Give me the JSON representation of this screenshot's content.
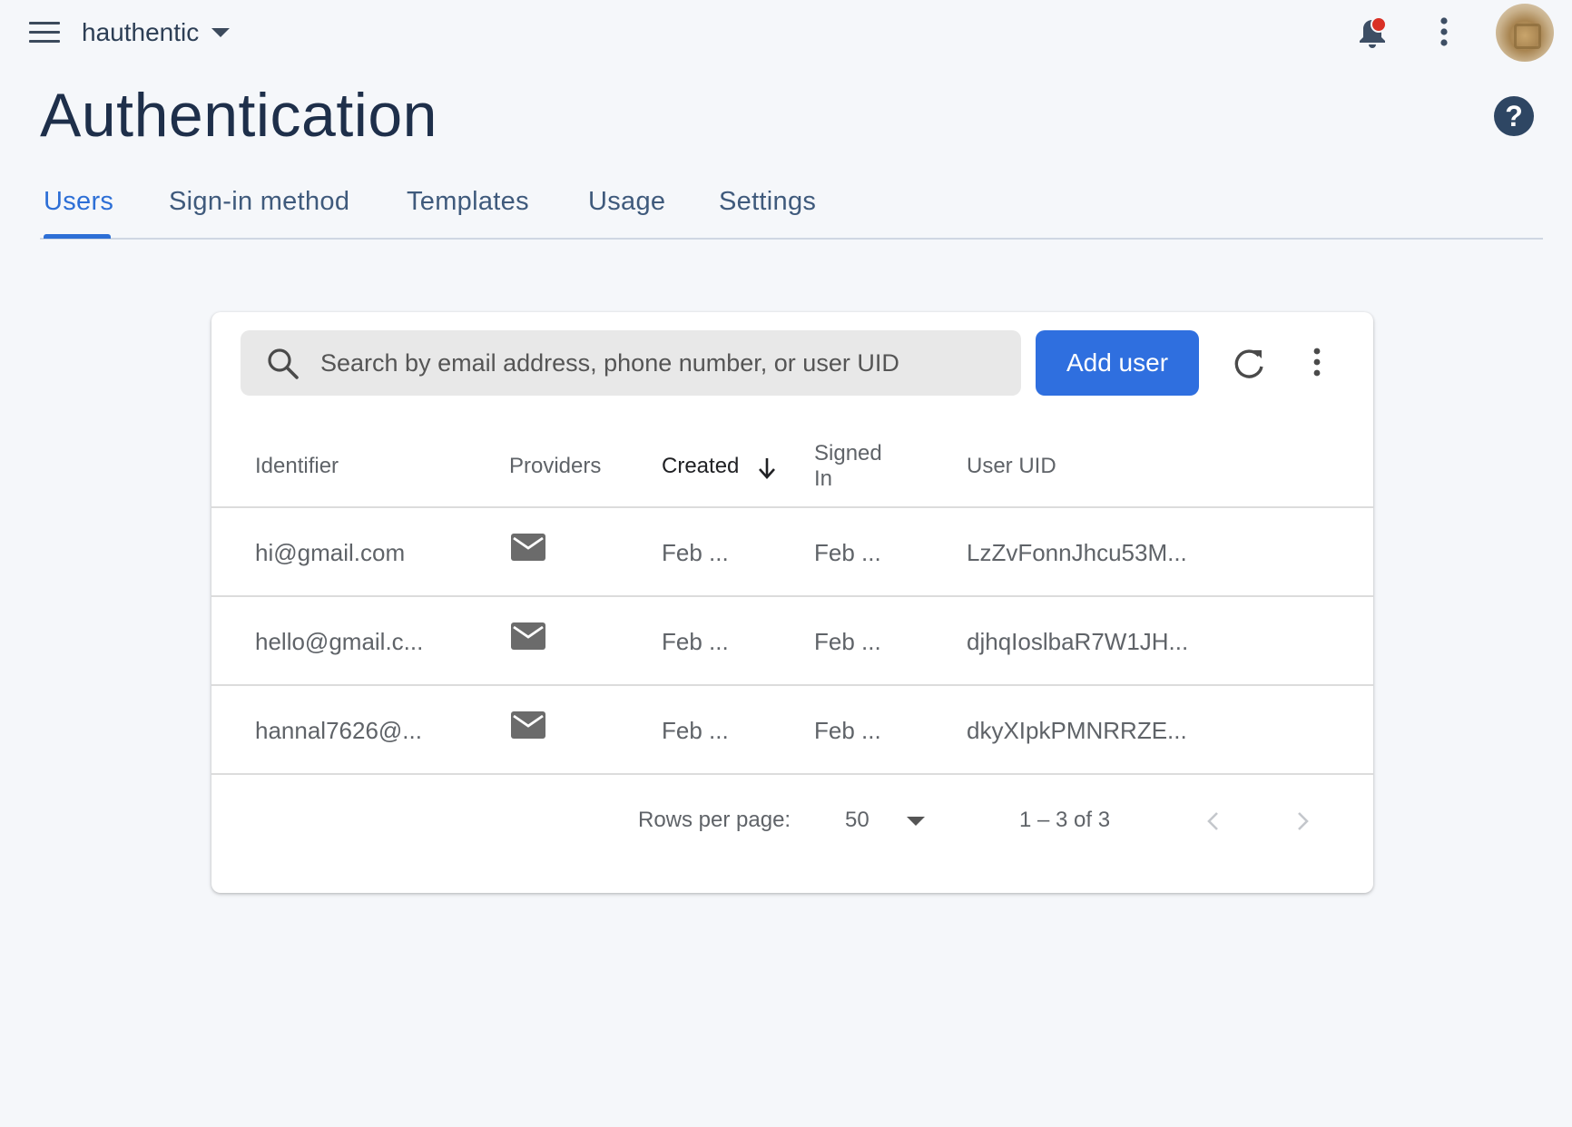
{
  "header": {
    "project_name": "hauthentic",
    "menu_icon": "menu-icon",
    "notification_icon": "bell-icon",
    "more_icon": "more-vert-icon",
    "avatar": "user-avatar"
  },
  "page": {
    "title": "Authentication",
    "help_label": "?"
  },
  "tabs": [
    {
      "label": "Users",
      "active": true
    },
    {
      "label": "Sign-in method",
      "active": false
    },
    {
      "label": "Templates",
      "active": false
    },
    {
      "label": "Usage",
      "active": false
    },
    {
      "label": "Settings",
      "active": false
    }
  ],
  "toolbar": {
    "search_placeholder": "Search by email address, phone number, or user UID",
    "search_value": "",
    "add_user_label": "Add user",
    "refresh_icon": "refresh-icon",
    "more_icon": "more-vert-icon"
  },
  "table": {
    "columns": [
      "Identifier",
      "Providers",
      "Created",
      "Signed In",
      "User UID"
    ],
    "sorted_column": "Created",
    "sort_direction": "descending",
    "rows": [
      {
        "identifier": "hi@gmail.com",
        "provider": "email-icon",
        "created": "Feb ...",
        "signed_in": "Feb ...",
        "uid": "LzZvFonnJhcu53M..."
      },
      {
        "identifier": "hello@gmail.c...",
        "provider": "email-icon",
        "created": "Feb ...",
        "signed_in": "Feb ...",
        "uid": "djhqIoslbaR7W1JH..."
      },
      {
        "identifier": "hannal7626@...",
        "provider": "email-icon",
        "created": "Feb ...",
        "signed_in": "Feb ...",
        "uid": "dkyXIpkPMNRRZE..."
      }
    ]
  },
  "pagination": {
    "rows_per_page_label": "Rows per page:",
    "rows_per_page_value": "50",
    "range_label": "1 – 3 of 3",
    "prev_icon": "chevron-left-icon",
    "next_icon": "chevron-right-icon"
  },
  "colors": {
    "accent": "#2f6fdf",
    "background": "#f5f7fa",
    "notification_dot": "#d93025"
  }
}
